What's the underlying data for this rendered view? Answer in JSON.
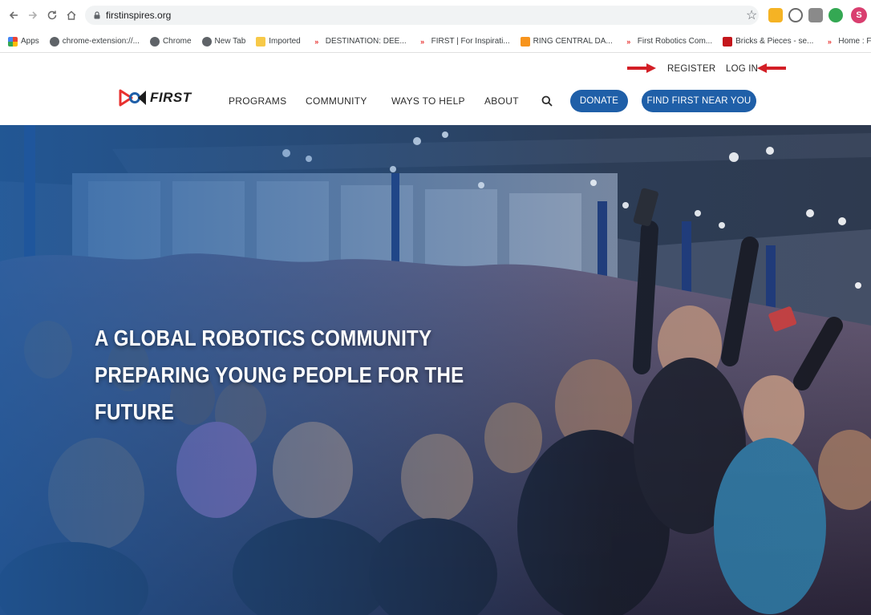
{
  "browser": {
    "url": "firstinspires.org",
    "bookmarks": [
      {
        "label": "Apps",
        "icon": "apps-grid-icon"
      },
      {
        "label": "chrome-extension://...",
        "icon": "globe-icon"
      },
      {
        "label": "Chrome",
        "icon": "globe-icon"
      },
      {
        "label": "New Tab",
        "icon": "globe-icon"
      },
      {
        "label": "Imported",
        "icon": "folder-icon"
      },
      {
        "label": "DESTINATION: DEE...",
        "icon": "first-logo-icon"
      },
      {
        "label": "FIRST | For Inspirati...",
        "icon": "first-logo-icon"
      },
      {
        "label": "RING CENTRAL DA...",
        "icon": "ring-icon"
      },
      {
        "label": "First Robotics Com...",
        "icon": "first-logo-icon"
      },
      {
        "label": "Bricks & Pieces - se...",
        "icon": "red-square-icon"
      },
      {
        "label": "Home : FRC Event...",
        "icon": "first-logo-icon"
      }
    ],
    "profile_initial": "S"
  },
  "site": {
    "utility_nav": {
      "register": "REGISTER",
      "login": "LOG IN"
    },
    "logo_text": "FIRST",
    "main_nav": {
      "programs": "PROGRAMS",
      "community": "COMMUNITY",
      "ways_to_help": "WAYS TO HELP",
      "about": "ABOUT"
    },
    "donate": "DONATE",
    "find_first": "FIND FIRST NEAR YOU"
  },
  "hero": {
    "lines": [
      "A GLOBAL ROBOTICS COMMUNITY",
      "PREPARING YOUNG PEOPLE FOR THE",
      "FUTURE"
    ]
  },
  "colors": {
    "brand_blue": "#1f5fa8",
    "arrow_red": "#d31f26",
    "first_red": "#e8312f"
  }
}
